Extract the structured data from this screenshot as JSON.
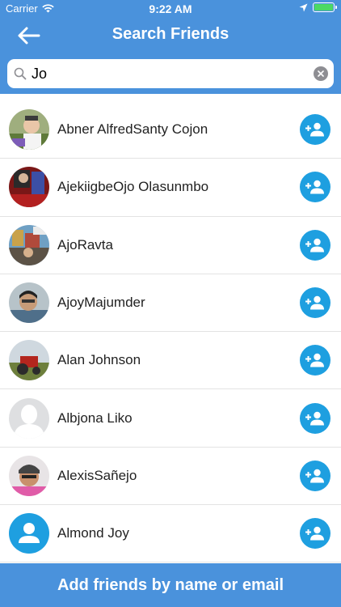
{
  "statusbar": {
    "carrier": "Carrier",
    "time": "9:22 AM"
  },
  "navbar": {
    "title": "Search Friends"
  },
  "search": {
    "value": "Jo"
  },
  "friends": [
    {
      "name": "Abner AlfredSanty Cojon",
      "avatar": "photo"
    },
    {
      "name": "AjekiigbeOjo Olasunmbo",
      "avatar": "photo"
    },
    {
      "name": "AjoRavta",
      "avatar": "photo"
    },
    {
      "name": "AjoyMajumder",
      "avatar": "photo"
    },
    {
      "name": "Alan Johnson",
      "avatar": "photo"
    },
    {
      "name": "Albjona Liko",
      "avatar": "default-silhouette"
    },
    {
      "name": "AlexisSañejo",
      "avatar": "photo"
    },
    {
      "name": "Almond Joy",
      "avatar": "default-person-icon"
    }
  ],
  "footer": {
    "label": "Add friends by name or email"
  },
  "colors": {
    "brand": "#4a92dc",
    "add_button": "#1e9fe0",
    "battery": "#4cd964"
  },
  "icons": {
    "back": "arrow-left-icon",
    "search": "search-icon",
    "clear": "clear-icon",
    "add": "add-person-icon"
  }
}
